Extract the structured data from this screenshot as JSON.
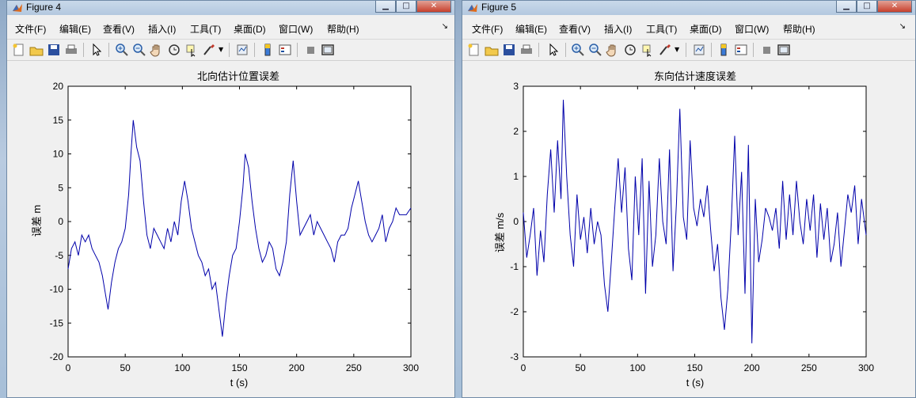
{
  "windows": [
    {
      "title": "Figure 4",
      "menu": [
        "文件(F)",
        "编辑(E)",
        "查看(V)",
        "插入(I)",
        "工具(T)",
        "桌面(D)",
        "窗口(W)",
        "帮助(H)"
      ],
      "chart_data": {
        "type": "line",
        "title": "北向估计位置误差",
        "xlabel": "t (s)",
        "ylabel": "误差 m",
        "xlim": [
          0,
          300
        ],
        "ylim": [
          -20,
          20
        ],
        "xticks": [
          0,
          50,
          100,
          150,
          200,
          250,
          300
        ],
        "yticks": [
          -20,
          -15,
          -10,
          -5,
          0,
          5,
          10,
          15,
          20
        ],
        "grid": false,
        "series": [
          {
            "color": "#0000aa",
            "x": [
              0,
              3,
              6,
              9,
              12,
              15,
              18,
              21,
              24,
              27,
              30,
              33,
              35,
              38,
              41,
              44,
              47,
              50,
              53,
              55,
              57,
              60,
              63,
              66,
              69,
              72,
              75,
              78,
              81,
              84,
              87,
              90,
              93,
              96,
              99,
              102,
              105,
              108,
              111,
              114,
              117,
              120,
              123,
              126,
              129,
              132,
              135,
              138,
              141,
              144,
              147,
              150,
              153,
              155,
              158,
              161,
              164,
              167,
              170,
              173,
              176,
              179,
              182,
              185,
              188,
              191,
              194,
              197,
              200,
              203,
              206,
              209,
              212,
              215,
              218,
              221,
              224,
              227,
              230,
              233,
              236,
              239,
              242,
              245,
              248,
              251,
              254,
              257,
              260,
              263,
              266,
              269,
              272,
              275,
              278,
              281,
              284,
              287,
              290,
              293,
              296,
              300
            ],
            "y": [
              -7,
              -4,
              -3,
              -5,
              -2,
              -3,
              -2,
              -4,
              -5,
              -6,
              -8,
              -11,
              -13,
              -9,
              -6,
              -4,
              -3,
              -1,
              4,
              10,
              15,
              11,
              9,
              3,
              -2,
              -4,
              -1,
              -2,
              -3,
              -4,
              -1,
              -3,
              0,
              -2,
              3,
              6,
              3,
              -1,
              -3,
              -5,
              -6,
              -8,
              -7,
              -10,
              -9,
              -13,
              -17,
              -12,
              -8,
              -5,
              -4,
              0,
              5,
              10,
              8,
              3,
              -1,
              -4,
              -6,
              -5,
              -3,
              -4,
              -7,
              -8,
              -6,
              -3,
              4,
              9,
              3,
              -2,
              -1,
              0,
              1,
              -2,
              0,
              -1,
              -2,
              -3,
              -4,
              -6,
              -3,
              -2,
              -2,
              -1,
              2,
              4,
              6,
              3,
              0,
              -2,
              -3,
              -2,
              -1,
              1,
              -3,
              -1,
              0,
              2,
              1,
              1,
              1,
              2
            ]
          }
        ]
      }
    },
    {
      "title": "Figure 5",
      "menu": [
        "文件(F)",
        "编辑(E)",
        "查看(V)",
        "插入(I)",
        "工具(T)",
        "桌面(D)",
        "窗口(W)",
        "帮助(H)"
      ],
      "chart_data": {
        "type": "line",
        "title": "东向估计速度误差",
        "xlabel": "t (s)",
        "ylabel": "误差 m/s",
        "xlim": [
          0,
          300
        ],
        "ylim": [
          -3,
          3
        ],
        "xticks": [
          0,
          50,
          100,
          150,
          200,
          250,
          300
        ],
        "yticks": [
          -3,
          -2,
          -1,
          0,
          1,
          2,
          3
        ],
        "grid": false,
        "series": [
          {
            "color": "#0000aa",
            "x": [
              0,
              3,
              6,
              9,
              12,
              15,
              18,
              21,
              24,
              27,
              30,
              33,
              35,
              38,
              41,
              44,
              47,
              50,
              53,
              56,
              59,
              62,
              65,
              68,
              71,
              74,
              77,
              80,
              83,
              86,
              89,
              92,
              95,
              98,
              101,
              104,
              107,
              110,
              113,
              116,
              119,
              122,
              125,
              128,
              131,
              134,
              137,
              140,
              143,
              146,
              149,
              152,
              155,
              158,
              161,
              164,
              167,
              170,
              173,
              176,
              179,
              182,
              185,
              188,
              191,
              194,
              197,
              200,
              203,
              206,
              209,
              212,
              215,
              218,
              221,
              224,
              227,
              230,
              233,
              236,
              239,
              242,
              245,
              248,
              251,
              254,
              257,
              260,
              263,
              266,
              269,
              272,
              275,
              278,
              281,
              284,
              287,
              290,
              293,
              296,
              300
            ],
            "y": [
              0.2,
              -0.8,
              -0.3,
              0.3,
              -1.2,
              -0.2,
              -0.9,
              0.6,
              1.6,
              0.2,
              1.8,
              0.5,
              2.7,
              1.0,
              -0.3,
              -1.0,
              0.6,
              -0.4,
              0.1,
              -0.7,
              0.3,
              -0.5,
              0.0,
              -0.3,
              -1.4,
              -2.0,
              -0.9,
              0.3,
              1.4,
              0.2,
              1.2,
              -0.6,
              -1.3,
              1.0,
              -0.3,
              1.4,
              -1.6,
              0.9,
              -1.0,
              -0.3,
              1.4,
              0.0,
              -0.5,
              1.6,
              -1.1,
              0.4,
              2.5,
              0.1,
              -0.4,
              1.8,
              0.3,
              -0.1,
              0.5,
              0.1,
              0.8,
              -0.2,
              -1.1,
              -0.5,
              -1.7,
              -2.4,
              -1.5,
              0.0,
              1.9,
              -0.3,
              1.1,
              -1.6,
              1.7,
              -2.7,
              0.5,
              -0.9,
              -0.4,
              0.3,
              0.1,
              -0.2,
              0.3,
              -0.6,
              0.9,
              -0.4,
              0.6,
              -0.3,
              0.9,
              0.0,
              -0.5,
              0.5,
              -0.2,
              0.6,
              -0.8,
              0.4,
              -0.4,
              0.3,
              -0.9,
              -0.5,
              0.2,
              -1.0,
              -0.2,
              0.6,
              0.2,
              0.8,
              -0.5,
              0.5,
              -0.3
            ]
          }
        ]
      }
    }
  ]
}
